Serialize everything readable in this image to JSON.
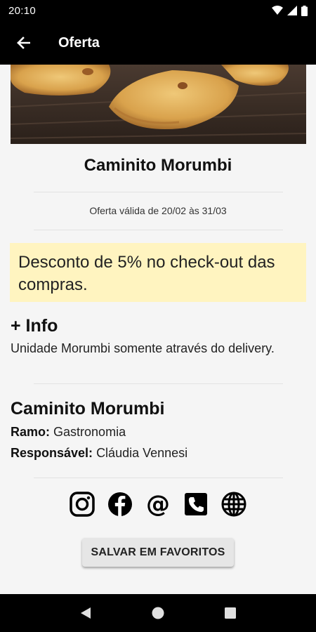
{
  "status_bar": {
    "time": "20:10"
  },
  "app_bar": {
    "title": "Oferta"
  },
  "store": {
    "name": "Caminito Morumbi"
  },
  "offer": {
    "validity": "Oferta válida de 20/02 às 31/03",
    "description": "Desconto de 5% no check-out das compras."
  },
  "info": {
    "heading": "+ Info",
    "text": "Unidade Morumbi somente através do delivery."
  },
  "company": {
    "name": "Caminito Morumbi",
    "branch_label": "Ramo:",
    "branch_value": "Gastronomia",
    "responsible_label": "Responsável:",
    "responsible_value": "Cláudia Vennesi"
  },
  "social": [
    "instagram-icon",
    "facebook-icon",
    "email-icon",
    "phone-icon",
    "website-icon"
  ],
  "actions": {
    "save_favorites": "SALVAR EM FAVORITOS"
  },
  "colors": {
    "highlight": "#fff4c0",
    "bar": "#000000"
  }
}
